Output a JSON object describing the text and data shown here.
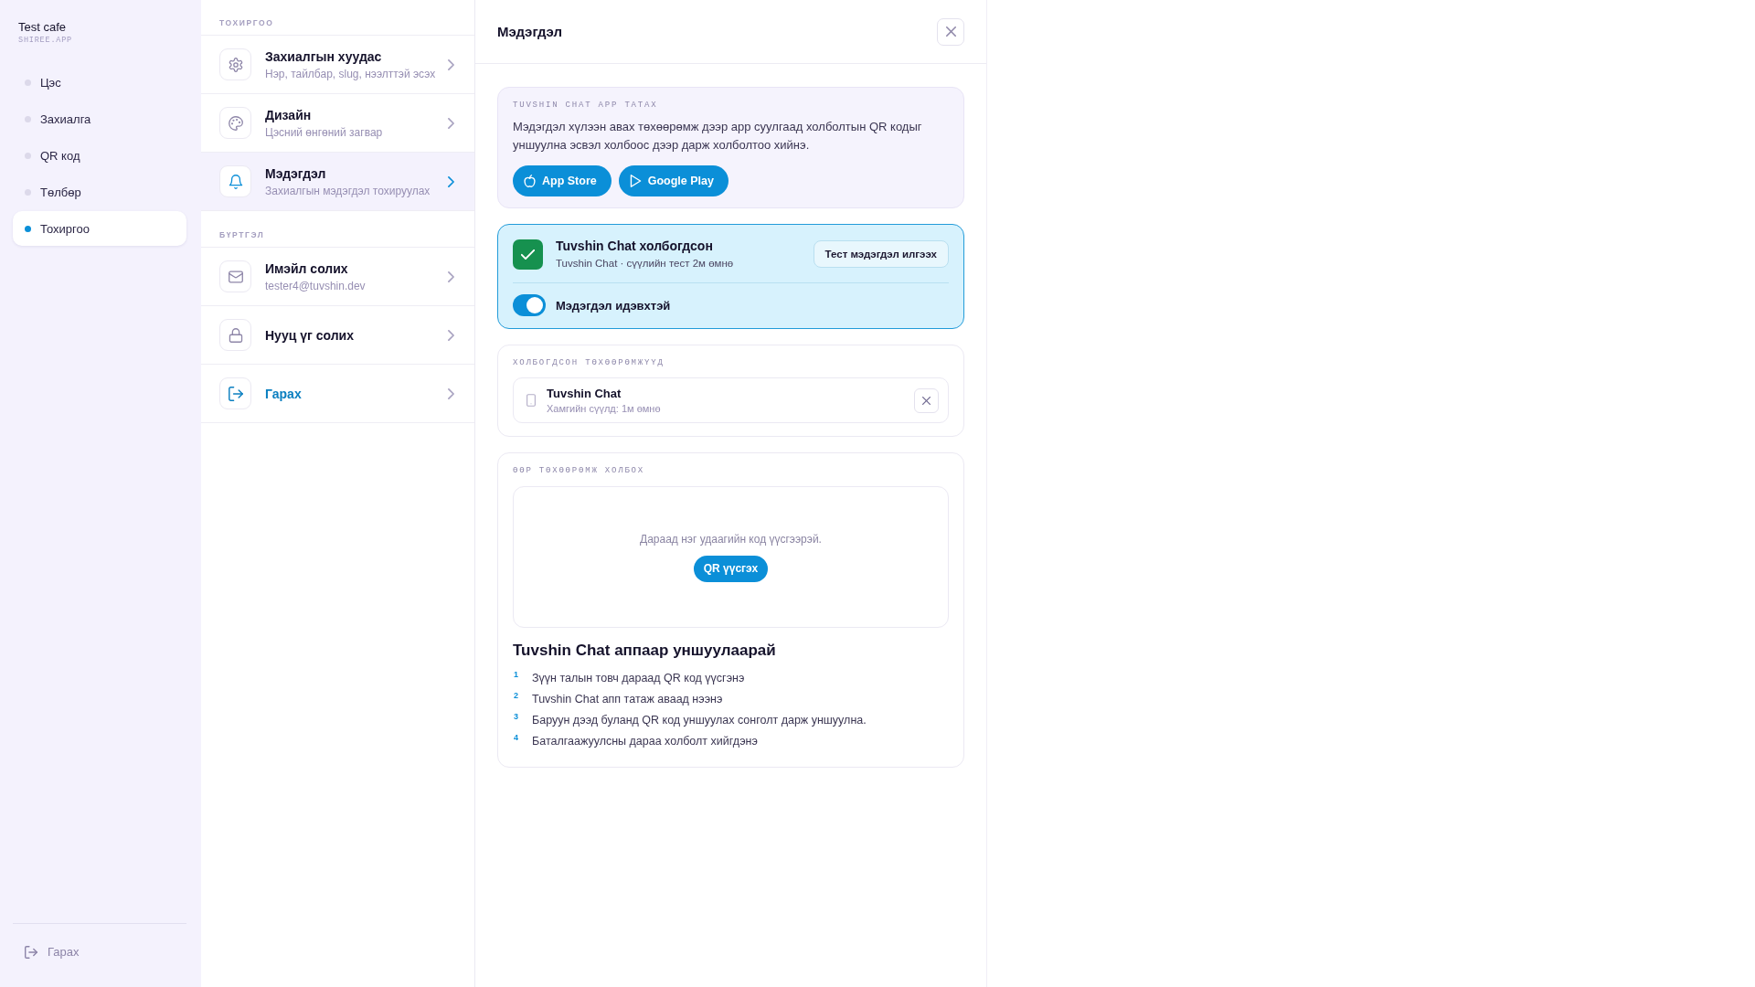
{
  "sidebar": {
    "brand": {
      "name": "Test cafe",
      "domain": "SHIREE.APP"
    },
    "items": [
      {
        "label": "Цэс",
        "selected": false
      },
      {
        "label": "Захиалга",
        "selected": false
      },
      {
        "label": "QR код",
        "selected": false
      },
      {
        "label": "Төлбөр",
        "selected": false
      },
      {
        "label": "Тохиргоо",
        "selected": true
      }
    ],
    "logout": {
      "label": "Гарах"
    }
  },
  "settings_menu": {
    "sections": [
      {
        "title": "ТОХИРГОО",
        "items": [
          {
            "kind": "setting",
            "title": "Захиалгын хуудас",
            "subtitle": "Нэр, тайлбар, slug, нээлттэй эсэх",
            "selected": false
          },
          {
            "kind": "setting",
            "title": "Дизайн",
            "subtitle": "Цэсний өнгөний загвар",
            "selected": false
          },
          {
            "kind": "setting",
            "title": "Мэдэгдэл",
            "subtitle": "Захиалгын мэдэгдэл тохируулах",
            "selected": true
          }
        ]
      },
      {
        "title": "БҮРТГЭЛ",
        "items": [
          {
            "kind": "setting",
            "title": "Имэйл солих",
            "subtitle": "tester4@tuvshin.dev",
            "selected": false
          },
          {
            "kind": "setting",
            "title": "Нууц үг солих",
            "selected": false
          },
          {
            "kind": "logout",
            "title": "Гарах",
            "selected": false
          }
        ]
      }
    ]
  },
  "detail": {
    "title": "Мэдэгдэл",
    "download_card": {
      "heading": "TUVSHIN CHAT APP TATAX",
      "text": "Мэдэгдэл хүлээн авах төхөөрөмж дээр app суулгаад холболтын QR кодыг уншуулна эсвэл холбоос дээр дарж холболтоо хийнэ.",
      "buttons": [
        {
          "label": "App Store"
        },
        {
          "label": "Google Play"
        }
      ]
    },
    "status_card": {
      "connected": true,
      "title": "Tuvshin Chat холбогдсон",
      "subtitle": "Tuvshin Chat · сүүлийн тест 2м өмнө",
      "test_button": "Тест мэдэгдэл илгээх",
      "toggle": {
        "label": "Мэдэгдэл идэвхтэй",
        "on": true
      }
    },
    "connected_devices": {
      "heading": "ХОЛБОГДСОН ТӨХӨӨРӨМЖҮҮД",
      "devices": [
        {
          "name": "Tuvshin Chat",
          "last_seen": "Хамгийн сүүлд: 1м өмнө"
        }
      ]
    },
    "link_device": {
      "heading": "ӨӨР ТӨХӨӨРӨМЖ ХОЛБОХ",
      "hint": "Дараад нэг удаагийн код үүсгээрэй.",
      "button": "QR үүсгэх",
      "instructions_title": "Tuvshin Chat аппаар уншуулаарай",
      "steps": [
        {
          "number": "1",
          "text": "Зүүн талын товч дараад QR код үүсгэнэ"
        },
        {
          "number": "2",
          "text": "Tuvshin Chat апп татаж аваад нээнэ"
        },
        {
          "number": "3",
          "text": "Баруун дээд буланд QR код уншуулах сонголт дарж уншуулна."
        },
        {
          "number": "4",
          "text": "Баталгаажуулсны дараа холболт хийгдэнэ"
        }
      ]
    }
  }
}
